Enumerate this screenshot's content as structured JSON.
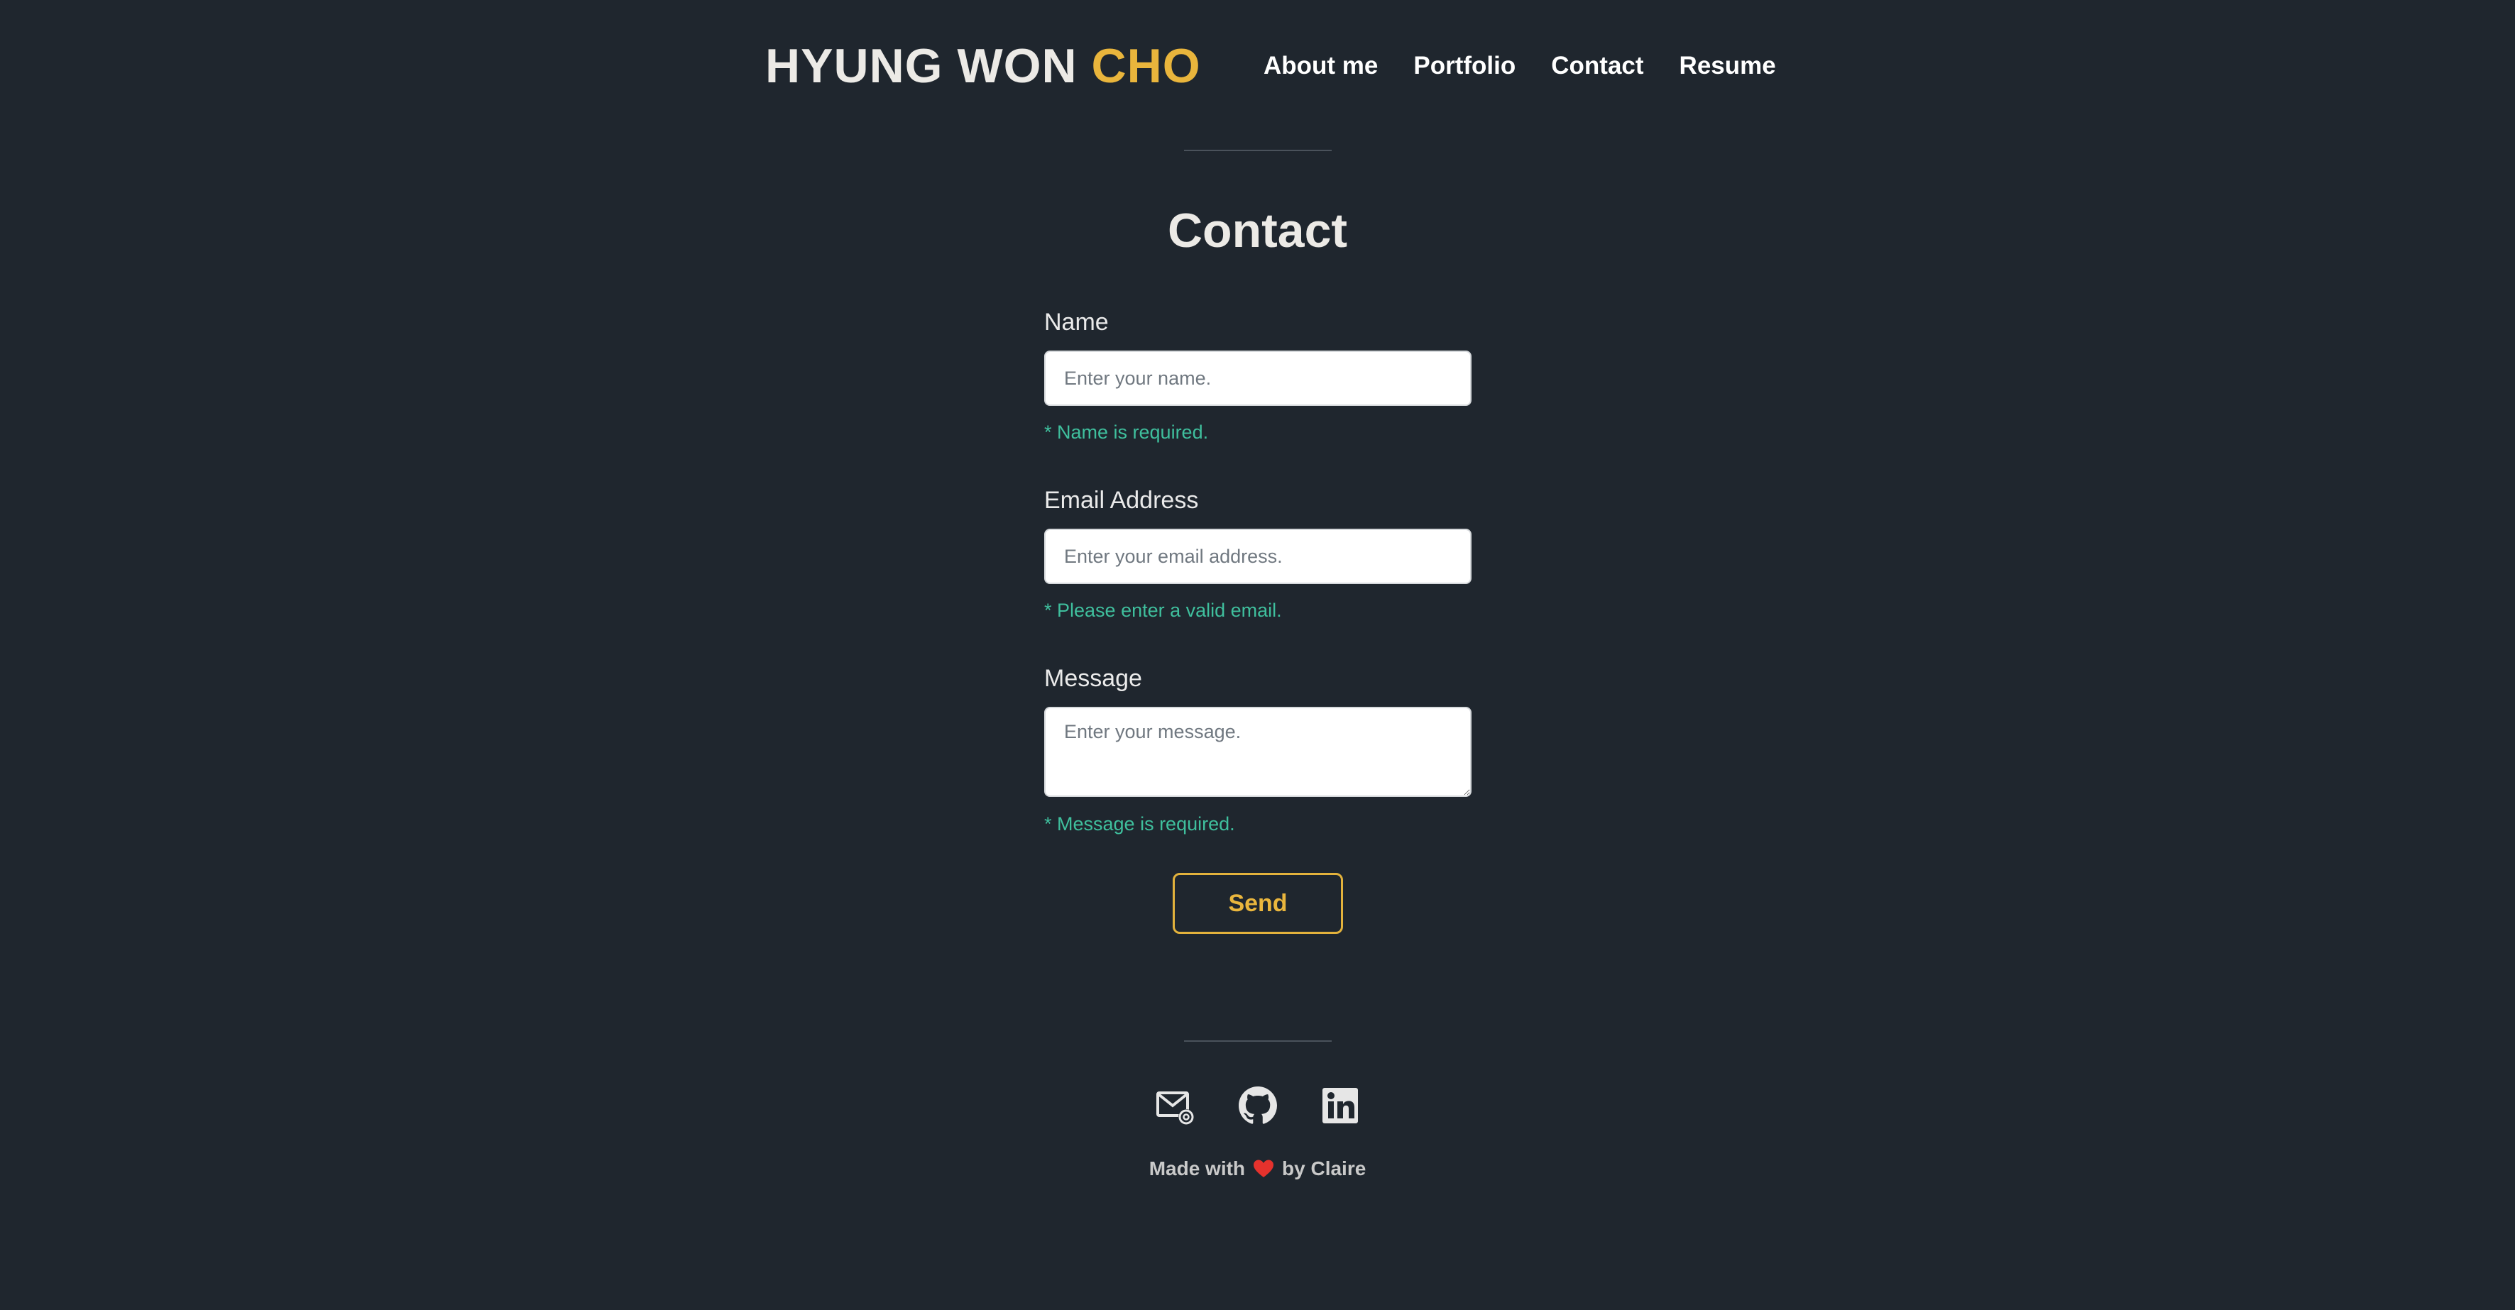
{
  "header": {
    "logo_main": "HYUNG WON ",
    "logo_accent": "CHO",
    "nav": [
      "About me",
      "Portfolio",
      "Contact",
      "Resume"
    ]
  },
  "page": {
    "title": "Contact"
  },
  "form": {
    "name": {
      "label": "Name",
      "placeholder": "Enter your name.",
      "value": "",
      "error": "* Name is required."
    },
    "email": {
      "label": "Email Address",
      "placeholder": "Enter your email address.",
      "value": "",
      "error": "* Please enter a valid email."
    },
    "message": {
      "label": "Message",
      "placeholder": "Enter your message.",
      "value": "",
      "error": "* Message is required."
    },
    "send_label": "Send"
  },
  "footer": {
    "social_icons": [
      "email-icon",
      "github-icon",
      "linkedin-icon"
    ],
    "made_with_prefix": "Made with",
    "made_with_suffix": "by Claire"
  },
  "colors": {
    "background": "#1f262e",
    "accent": "#e9b53c",
    "error": "#3fbf9d",
    "heart": "#e5322d"
  }
}
